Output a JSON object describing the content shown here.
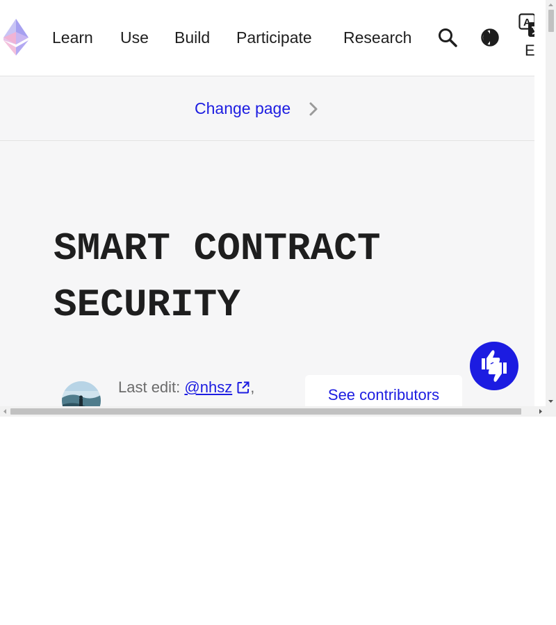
{
  "nav": {
    "items": [
      {
        "label": "Learn"
      },
      {
        "label": "Use"
      },
      {
        "label": "Build"
      },
      {
        "label": "Participate"
      },
      {
        "label": "Research"
      }
    ],
    "language": "EN",
    "icons": [
      "ethereum-logo",
      "search-icon",
      "theme-toggle-icon",
      "translate-icon"
    ]
  },
  "change_page": {
    "label": "Change page"
  },
  "hero": {
    "title": "SMART CONTRACT SECURITY",
    "last_edit_prefix": "Last edit:",
    "editor": "@nhsz",
    "separator": ",",
    "contributors_button": "See contributors"
  },
  "colors": {
    "accent": "#1c1ce1",
    "text": "#1e1e1e",
    "muted": "#6b6b6b",
    "page_background": "#f6f6f7"
  }
}
